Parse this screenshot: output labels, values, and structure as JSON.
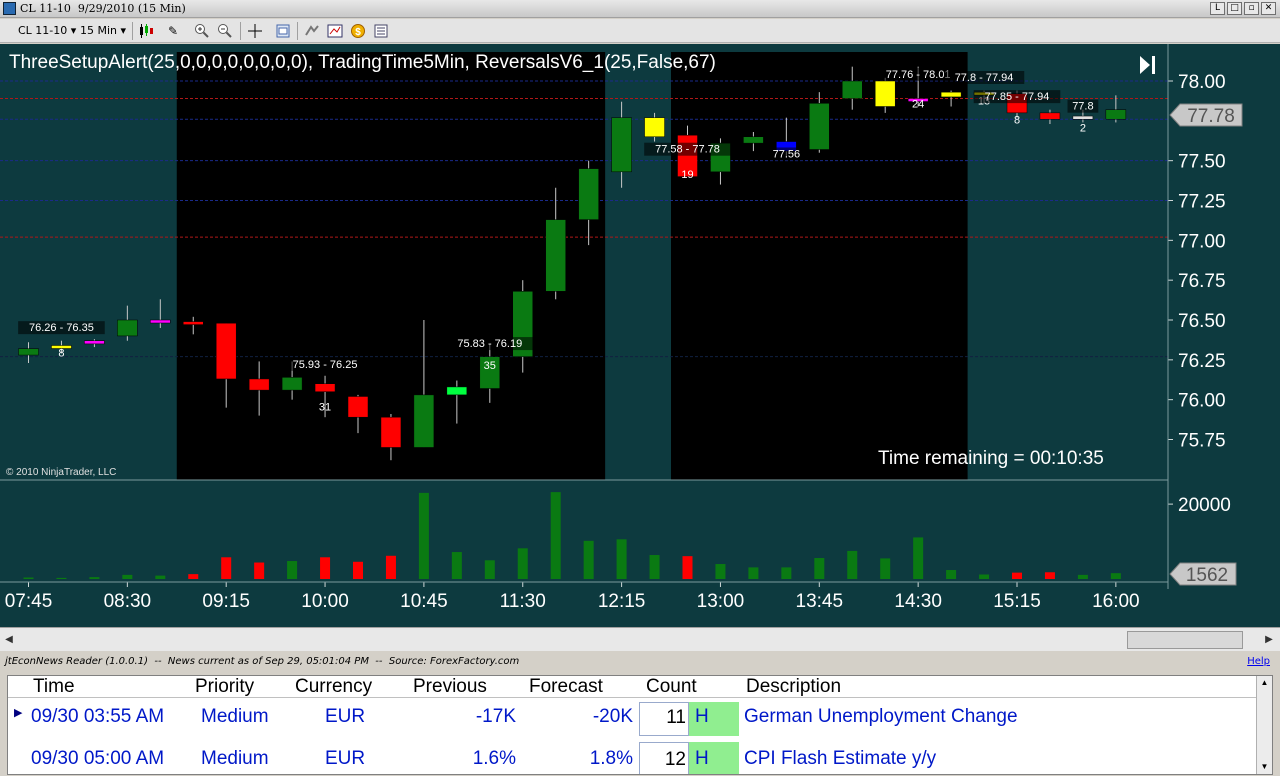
{
  "window": {
    "title": "CL 11-10  9/29/2010 (15 Min)",
    "buttons": [
      "L",
      "□",
      "▫",
      "✕"
    ]
  },
  "toolbar": {
    "instrument": "CL 11-10",
    "interval": "15 Min",
    "icons": [
      "candlestick-icon",
      "pencil-draw-icon",
      "zoom-in-icon",
      "zoom-out-icon",
      "crosshair-icon",
      "properties-icon",
      "data-box-icon",
      "chart-trader-icon",
      "strategy-icon",
      "list-icon"
    ]
  },
  "chart": {
    "indicator_label": "ThreeSetupAlert(25,0,0,0,0,0,0,0,0), TradingTime5Min, ReversalsV6_1(25,False,67)",
    "copyright": "© 2010 NinjaTrader, LLC",
    "time_remaining": "Time remaining = 00:10:35",
    "last_price": "77.78",
    "last_volume": "1562",
    "colors": {
      "background": "#0d3a3f",
      "session_shade": "#000000",
      "up": "#0a7a12",
      "down": "#ff0000",
      "neutral_yellow": "#ffff00",
      "neutral_magenta": "#ff00ff",
      "blue": "#0000ff",
      "lime": "#00ff40"
    },
    "price_ticks": [
      "78.00",
      "77.50",
      "77.25",
      "77.00",
      "76.75",
      "76.50",
      "76.25",
      "76.00",
      "75.75"
    ],
    "volume_ticks": [
      "20000"
    ],
    "time_ticks": [
      "07:45",
      "08:30",
      "09:15",
      "10:00",
      "10:45",
      "11:30",
      "12:15",
      "13:00",
      "13:45",
      "14:30",
      "15:15",
      "16:00"
    ],
    "annotations": [
      {
        "text": "76.26 - 76.35",
        "count": "8"
      },
      {
        "text": "75.93 - 76.25",
        "count": "31"
      },
      {
        "text": "75.83 - 76.19",
        "count": "35"
      },
      {
        "text": "77.58 - 77.78",
        "count": "19"
      },
      {
        "text": "77.56",
        "count": ""
      },
      {
        "text": "77.76 - 78.01",
        "count": "24"
      },
      {
        "text": "77.8 - 77.94",
        "count": "13"
      },
      {
        "text": "77.85 - 77.94",
        "count": "8"
      },
      {
        "text": "77.8",
        "count": "2"
      }
    ]
  },
  "chart_data": {
    "type": "candlestick",
    "title": "",
    "candles": [
      {
        "time": "07:45",
        "open": 76.28,
        "high": 76.36,
        "low": 76.23,
        "close": 76.32,
        "color": "up",
        "volume": 400
      },
      {
        "time": "08:00",
        "open": 76.33,
        "high": 76.37,
        "low": 76.29,
        "close": 76.34,
        "color": "yellow",
        "volume": 300
      },
      {
        "time": "08:15",
        "open": 76.35,
        "high": 76.38,
        "low": 76.33,
        "close": 76.37,
        "color": "magenta",
        "volume": 500
      },
      {
        "time": "08:30",
        "open": 76.4,
        "high": 76.59,
        "low": 76.37,
        "close": 76.5,
        "color": "up",
        "volume": 1100
      },
      {
        "time": "08:45",
        "open": 76.49,
        "high": 76.63,
        "low": 76.45,
        "close": 76.5,
        "color": "magenta",
        "volume": 900
      },
      {
        "time": "09:00",
        "open": 76.49,
        "high": 76.52,
        "low": 76.41,
        "close": 76.48,
        "color": "down",
        "volume": 1300
      },
      {
        "time": "09:15",
        "open": 76.48,
        "high": 76.48,
        "low": 75.95,
        "close": 76.13,
        "color": "down",
        "volume": 5800
      },
      {
        "time": "09:30",
        "open": 76.13,
        "high": 76.24,
        "low": 75.9,
        "close": 76.06,
        "color": "down",
        "volume": 4400
      },
      {
        "time": "09:45",
        "open": 76.06,
        "high": 76.24,
        "low": 76.0,
        "close": 76.14,
        "color": "up",
        "volume": 4800
      },
      {
        "time": "10:00",
        "open": 76.1,
        "high": 76.15,
        "low": 75.89,
        "close": 76.05,
        "color": "down",
        "volume": 5800
      },
      {
        "time": "10:15",
        "open": 76.02,
        "high": 76.03,
        "low": 75.79,
        "close": 75.89,
        "color": "down",
        "volume": 4600
      },
      {
        "time": "10:30",
        "open": 75.89,
        "high": 75.91,
        "low": 75.62,
        "close": 75.7,
        "color": "down",
        "volume": 6200
      },
      {
        "time": "10:45",
        "open": 75.7,
        "high": 76.5,
        "low": 75.7,
        "close": 76.03,
        "color": "up",
        "volume": 23000
      },
      {
        "time": "11:00",
        "open": 76.03,
        "high": 76.12,
        "low": 75.85,
        "close": 76.08,
        "color": "lime",
        "volume": 7200
      },
      {
        "time": "11:15",
        "open": 76.07,
        "high": 76.35,
        "low": 75.98,
        "close": 76.27,
        "color": "up",
        "volume": 5000
      },
      {
        "time": "11:30",
        "open": 76.27,
        "high": 76.75,
        "low": 76.17,
        "close": 76.68,
        "color": "up",
        "volume": 8200
      },
      {
        "time": "11:45",
        "open": 76.68,
        "high": 77.33,
        "low": 76.63,
        "close": 77.13,
        "color": "up",
        "volume": 23200
      },
      {
        "time": "12:00",
        "open": 77.13,
        "high": 77.5,
        "low": 76.97,
        "close": 77.45,
        "color": "up",
        "volume": 10200
      },
      {
        "time": "12:15",
        "open": 77.43,
        "high": 77.87,
        "low": 77.33,
        "close": 77.77,
        "color": "up",
        "volume": 10600
      },
      {
        "time": "12:30",
        "open": 77.77,
        "high": 77.8,
        "low": 77.62,
        "close": 77.65,
        "color": "yellow",
        "volume": 6400
      },
      {
        "time": "12:45",
        "open": 77.66,
        "high": 77.72,
        "low": 77.4,
        "close": 77.4,
        "color": "down",
        "volume": 6100
      },
      {
        "time": "13:00",
        "open": 77.43,
        "high": 77.64,
        "low": 77.35,
        "close": 77.61,
        "color": "up",
        "volume": 4000
      },
      {
        "time": "13:15",
        "open": 77.61,
        "high": 77.68,
        "low": 77.56,
        "close": 77.65,
        "color": "up",
        "volume": 3100
      },
      {
        "time": "13:30",
        "open": 77.56,
        "high": 77.77,
        "low": 77.52,
        "close": 77.62,
        "color": "blue",
        "volume": 3100
      },
      {
        "time": "13:45",
        "open": 77.57,
        "high": 77.93,
        "low": 77.55,
        "close": 77.86,
        "color": "up",
        "volume": 5600
      },
      {
        "time": "14:00",
        "open": 77.89,
        "high": 78.09,
        "low": 77.82,
        "close": 78.0,
        "color": "up",
        "volume": 7500
      },
      {
        "time": "14:15",
        "open": 78.0,
        "high": 78.02,
        "low": 77.8,
        "close": 77.84,
        "color": "yellow",
        "volume": 5500
      },
      {
        "time": "14:30",
        "open": 77.89,
        "high": 78.09,
        "low": 77.84,
        "close": 77.89,
        "color": "magenta",
        "volume": 11100
      },
      {
        "time": "14:45",
        "open": 77.93,
        "high": 77.94,
        "low": 77.84,
        "close": 77.9,
        "color": "yellow",
        "volume": 2400
      },
      {
        "time": "15:00",
        "open": 77.93,
        "high": 77.94,
        "low": 77.86,
        "close": 77.92,
        "color": "yellow",
        "volume": 1200
      },
      {
        "time": "15:15",
        "open": 77.92,
        "high": 77.94,
        "low": 77.77,
        "close": 77.8,
        "color": "down",
        "volume": 1700
      },
      {
        "time": "15:30",
        "open": 77.8,
        "high": 77.82,
        "low": 77.73,
        "close": 77.76,
        "color": "down",
        "volume": 1800
      },
      {
        "time": "15:45",
        "open": 77.78,
        "high": 77.82,
        "low": 77.74,
        "close": 77.76,
        "color": "white",
        "volume": 1100
      },
      {
        "time": "16:00",
        "open": 77.76,
        "high": 77.91,
        "low": 77.74,
        "close": 77.82,
        "color": "up",
        "volume": 1562
      }
    ],
    "price_range": [
      75.55,
      78.12
    ],
    "volume_range": [
      0,
      24500
    ],
    "horizontal_lines": [
      {
        "price": 78.0,
        "color": "#1a2a8a",
        "style": "dashed"
      },
      {
        "price": 77.89,
        "color": "#b01818",
        "style": "dashed"
      },
      {
        "price": 77.76,
        "color": "#1a2a8a",
        "style": "dashed"
      },
      {
        "price": 77.5,
        "color": "#1a2a8a",
        "style": "dashed"
      },
      {
        "price": 77.25,
        "color": "#1a2a8a",
        "style": "dashed"
      },
      {
        "price": 77.02,
        "color": "#b01818",
        "style": "dashed"
      },
      {
        "price": 76.27,
        "color": "#102040",
        "style": "dashed"
      }
    ],
    "shaded_sessions": [
      {
        "from": "09:00",
        "to": "12:00"
      },
      {
        "from": "12:45",
        "to": "14:45"
      }
    ]
  },
  "news": {
    "header": "jtEconNews Reader (1.0.0.1)  --  News current as of Sep 29, 05:01:04 PM  --  Source: ForexFactory.com",
    "help": "Help",
    "columns": [
      "Time",
      "Priority",
      "Currency",
      "Previous",
      "Forecast",
      "Count",
      "Description"
    ],
    "rows": [
      {
        "time": "09/30 03:55 AM",
        "priority": "Medium",
        "currency": "EUR",
        "previous": "-17K",
        "forecast": "-20K",
        "count": "11",
        "flag": "H",
        "description": "German Unemployment Change"
      },
      {
        "time": "09/30 05:00 AM",
        "priority": "Medium",
        "currency": "EUR",
        "previous": "1.6%",
        "forecast": "1.8%",
        "count": "12",
        "flag": "H",
        "description": "CPI Flash Estimate y/y"
      }
    ]
  }
}
